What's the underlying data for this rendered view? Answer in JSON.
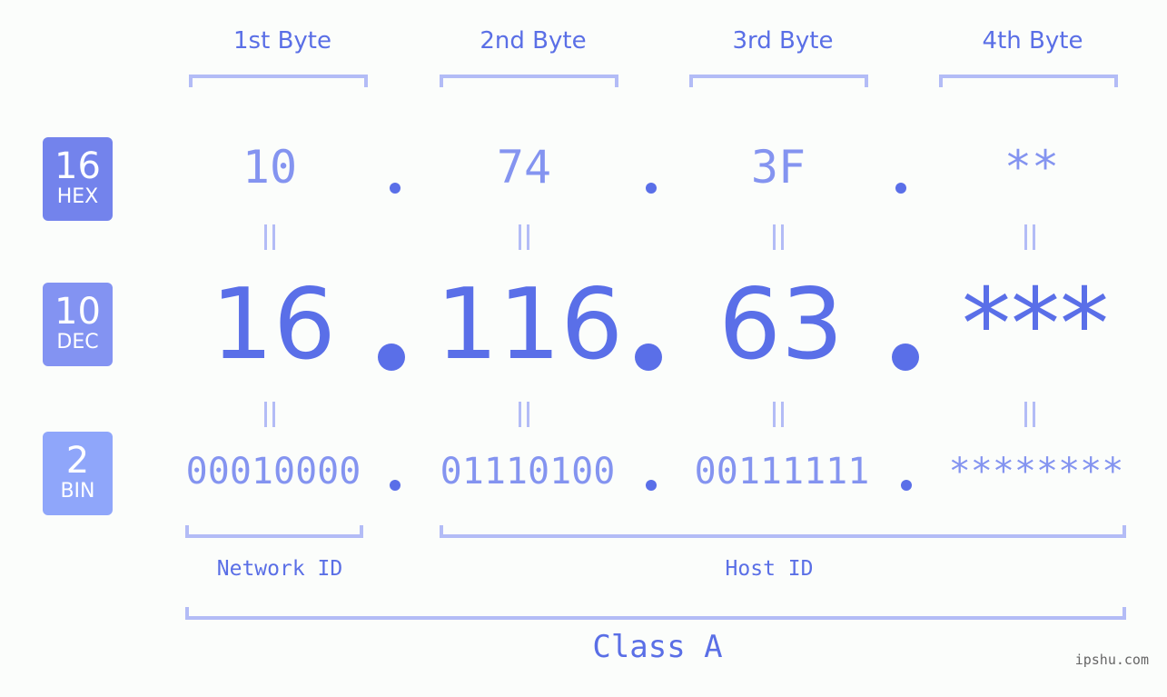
{
  "headers": [
    "1st Byte",
    "2nd Byte",
    "3rd Byte",
    "4th Byte"
  ],
  "badges": {
    "hex": {
      "num": "16",
      "label": "HEX",
      "color": "#7383ec"
    },
    "dec": {
      "num": "10",
      "label": "DEC",
      "color": "#8393f2"
    },
    "bin": {
      "num": "2",
      "label": "BIN",
      "color": "#8fa6fa"
    }
  },
  "hex": [
    "10",
    "74",
    "3F",
    "**"
  ],
  "dec": [
    "16",
    "116",
    "63",
    "***"
  ],
  "bin": [
    "00010000",
    "01110100",
    "00111111",
    "********"
  ],
  "network_label": "Network ID",
  "host_label": "Host ID",
  "class_label": "Class A",
  "watermark": "ipshu.com",
  "colors": {
    "accent": "#5a6fe8",
    "light": "#8494f0",
    "bracket": "#b3bcf6"
  }
}
